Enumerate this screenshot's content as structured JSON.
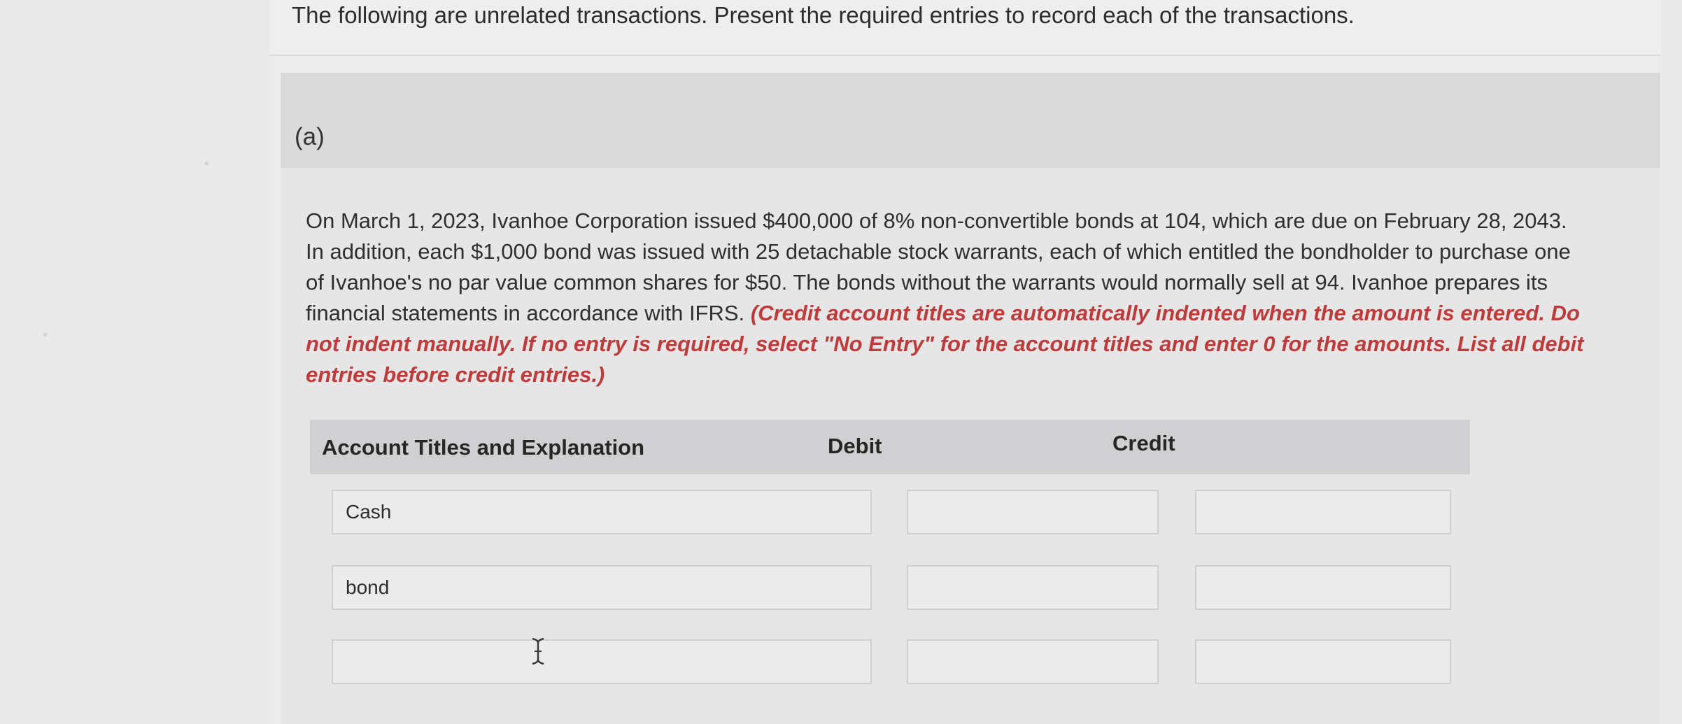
{
  "intro": {
    "text": "The following are unrelated transactions. Present the required entries to record each of the transactions."
  },
  "part": {
    "label": "(a)"
  },
  "problem": {
    "text": "On March 1, 2023, Ivanhoe Corporation issued $400,000 of 8% non-convertible bonds at 104, which are due on February 28, 2043. In addition, each $1,000 bond was issued with 25 detachable stock warrants, each of which entitled the bondholder to purchase one of Ivanhoe's no par value common shares for $50. The bonds without the warrants would normally sell at 94. Ivanhoe prepares its financial statements in accordance with IFRS.",
    "instructions": "(Credit account titles are automatically indented when the amount is entered. Do not indent manually. If no entry is required, select \"No Entry\" for the account titles and enter 0 for the amounts. List all debit entries before credit entries.)"
  },
  "table": {
    "headers": {
      "account": "Account Titles and Explanation",
      "debit": "Debit",
      "credit": "Credit"
    },
    "rows": [
      {
        "account": "Cash",
        "debit": "",
        "credit": ""
      },
      {
        "account": "bond",
        "debit": "",
        "credit": ""
      },
      {
        "account": "",
        "debit": "",
        "credit": ""
      }
    ]
  },
  "colors": {
    "instruction_red": "#bf3b3b",
    "header_gray": "#d0d0d2",
    "page_bg": "#e9e9ea"
  },
  "icons": {
    "cursor": "text-cursor-icon"
  }
}
